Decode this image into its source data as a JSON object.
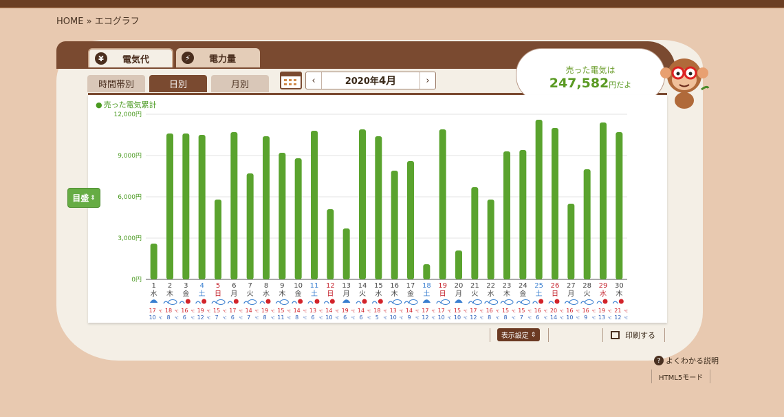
{
  "breadcrumb": {
    "home": "HOME",
    "sep": "»",
    "current": "エコグラフ"
  },
  "tabs": {
    "electricity_fee": "電気代",
    "electricity_amount": "電力量",
    "fee_icon": "¥",
    "amount_icon": "⚡"
  },
  "subtabs": {
    "hourly": "時間帯別",
    "daily": "日別",
    "monthly": "月別"
  },
  "period": {
    "prev": "‹",
    "year": "2020年",
    "month": "4月",
    "next": "›"
  },
  "summary": {
    "label": "売った電気は",
    "amount": "247,582",
    "suffix": "円だよ"
  },
  "gauge_button": "目盛",
  "gauge_arrows": "⇕",
  "display_settings": "表示設定",
  "print": "印刷する",
  "help": "よくわかる説明",
  "html5": "HTML5モード",
  "colors": {
    "bar": "#5aa32e",
    "weekday": "#444444",
    "saturday": "#3a7fd0",
    "sunday": "#c3202a",
    "high_temp": "#d2232a",
    "low_temp": "#2a5db8",
    "brown": "#7a4a30"
  },
  "chart_data": {
    "type": "bar",
    "title": "",
    "legend": "売った電気累計",
    "ylim": [
      0,
      12000
    ],
    "y_ticks": [
      "0円",
      "3,000円",
      "6,000円",
      "9,000円",
      "12,000円"
    ],
    "y_tick_values": [
      0,
      3000,
      6000,
      9000,
      12000
    ],
    "categories": [
      "1",
      "2",
      "3",
      "4",
      "5",
      "6",
      "7",
      "8",
      "9",
      "10",
      "11",
      "12",
      "13",
      "14",
      "15",
      "16",
      "17",
      "18",
      "19",
      "20",
      "21",
      "22",
      "23",
      "24",
      "25",
      "26",
      "27",
      "28",
      "29",
      "30"
    ],
    "weekdays": [
      "水",
      "木",
      "金",
      "土",
      "日",
      "月",
      "火",
      "水",
      "木",
      "金",
      "土",
      "日",
      "月",
      "火",
      "水",
      "木",
      "金",
      "土",
      "日",
      "月",
      "火",
      "水",
      "木",
      "金",
      "土",
      "日",
      "月",
      "火",
      "水",
      "木"
    ],
    "day_types": [
      "w",
      "w",
      "w",
      "sat",
      "sun",
      "w",
      "w",
      "w",
      "w",
      "w",
      "sat",
      "sun",
      "w",
      "w",
      "w",
      "w",
      "w",
      "sat",
      "sun",
      "w",
      "w",
      "w",
      "w",
      "w",
      "sat",
      "sun",
      "w",
      "w",
      "sun",
      "w"
    ],
    "values": [
      2600,
      10600,
      10600,
      10500,
      5800,
      10700,
      7700,
      10400,
      9200,
      8800,
      10800,
      5100,
      3700,
      10900,
      10400,
      7900,
      8600,
      1100,
      10900,
      2100,
      6700,
      5800,
      9300,
      9400,
      11600,
      11000,
      5500,
      8000,
      11400,
      10700
    ],
    "weather_icons": [
      "rain",
      "rain-cloud",
      "sun-rain",
      "sun-rain",
      "rain-cloud",
      "sun-rain",
      "cloud-rain",
      "sun-rain",
      "cloud-rain",
      "sun-rain",
      "rain-sun",
      "sun-rain",
      "rain",
      "sun-rain",
      "sun-rain",
      "rain-cloud",
      "rain-cloud",
      "rain",
      "rain-cloud",
      "rain",
      "rain-cloud",
      "rain-cloud",
      "cloud-rain",
      "rain-cloud",
      "sun-rain",
      "sun-rain",
      "rain-cloud",
      "cloud-rain",
      "sun-rain",
      "sun-rain"
    ],
    "high_temps": [
      17,
      18,
      16,
      19,
      15,
      17,
      14,
      19,
      15,
      14,
      13,
      14,
      19,
      14,
      18,
      13,
      14,
      17,
      17,
      15,
      17,
      16,
      15,
      15,
      16,
      20,
      16,
      16,
      19,
      21
    ],
    "low_temps": [
      10,
      8,
      6,
      12,
      7,
      6,
      7,
      8,
      11,
      8,
      6,
      10,
      6,
      6,
      5,
      10,
      9,
      12,
      10,
      10,
      12,
      8,
      8,
      7,
      6,
      14,
      10,
      9,
      13,
      12
    ],
    "temp_unit": "℃"
  }
}
